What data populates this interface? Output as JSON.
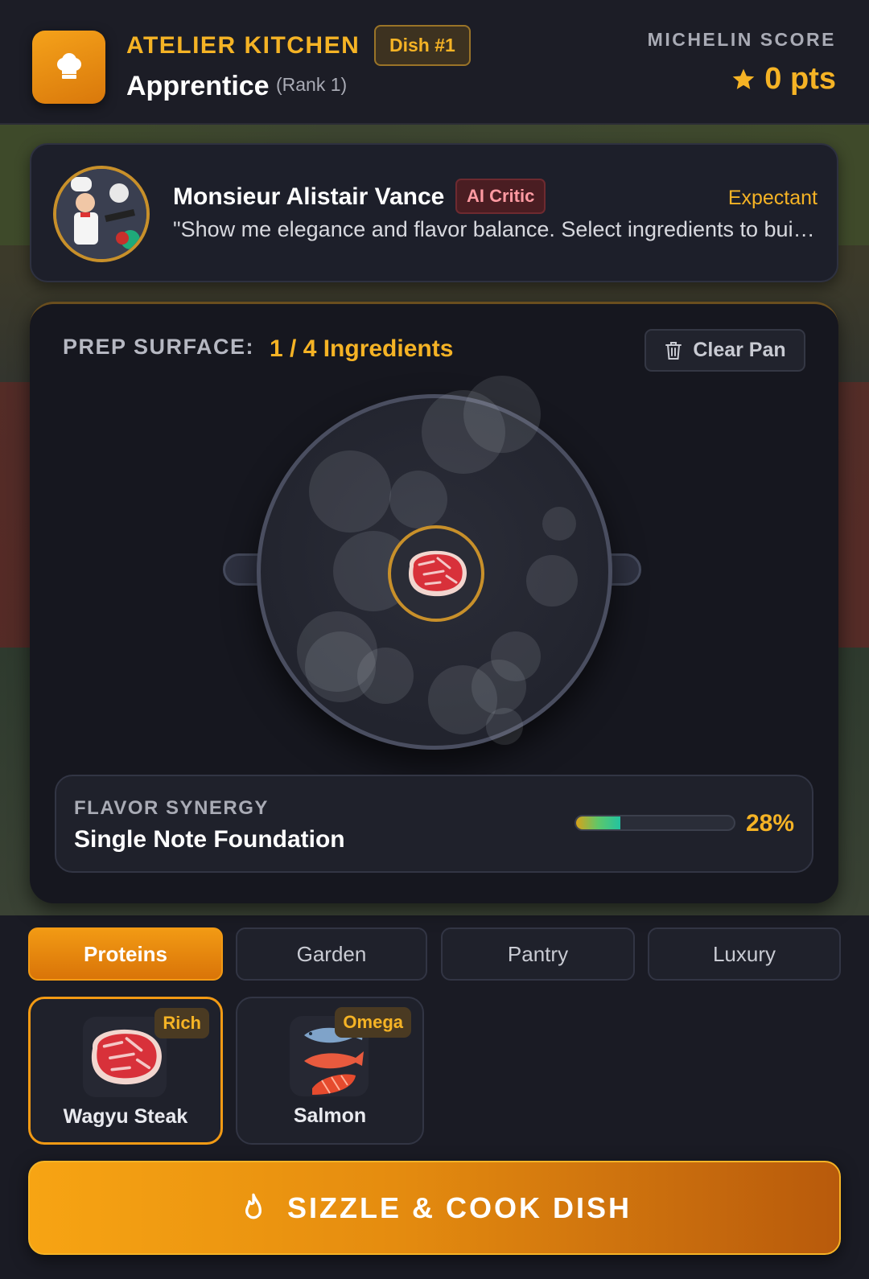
{
  "header": {
    "brand": "ATELIER KITCHEN",
    "dish_badge": "Dish #1",
    "rank_title": "Apprentice",
    "rank_sub": "(Rank 1)",
    "score_label": "MICHELIN SCORE",
    "score_value": "0 pts"
  },
  "critic": {
    "name": "Monsieur Alistair Vance",
    "tag": "AI Critic",
    "mood": "Expectant",
    "quote": "\"Show me elegance and flavor balance. Select ingredients to build your dish.\""
  },
  "prep": {
    "label": "PREP SURFACE:",
    "count": "1 / 4 Ingredients",
    "clear_label": "Clear Pan",
    "pan_items": [
      "steak-icon"
    ]
  },
  "synergy": {
    "label": "FLAVOR SYNERGY",
    "title": "Single Note Foundation",
    "percent_text": "28%",
    "percent": 28
  },
  "tabs": [
    {
      "label": "Proteins",
      "active": true
    },
    {
      "label": "Garden",
      "active": false
    },
    {
      "label": "Pantry",
      "active": false
    },
    {
      "label": "Luxury",
      "active": false
    }
  ],
  "ingredients": [
    {
      "name": "Wagyu Steak",
      "tag": "Rich",
      "icon": "steak-icon",
      "selected": true
    },
    {
      "name": "Salmon",
      "tag": "Omega",
      "icon": "salmon-icon",
      "selected": false
    }
  ],
  "cook_button": {
    "label": "SIZZLE & COOK DISH",
    "icon": "flame-icon"
  },
  "colors": {
    "accent": "#f5b325",
    "orange": "#f29a14",
    "panel": "#1f212b"
  }
}
